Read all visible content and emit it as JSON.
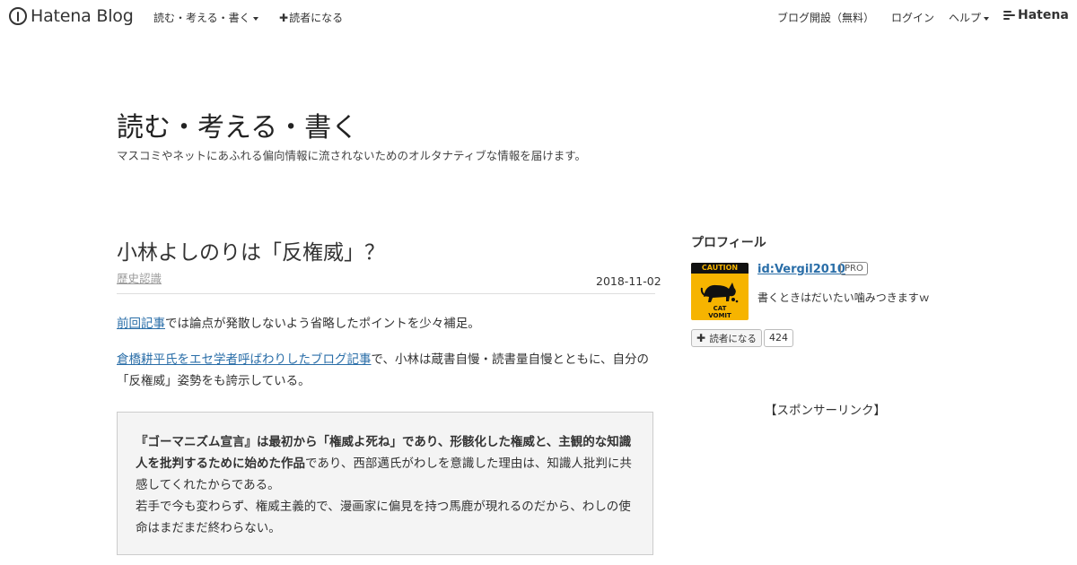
{
  "global_header": {
    "logo_text": "Hatena Blog",
    "blog_menu_label": "読む・考える・書く",
    "subscribe_label": "読者になる",
    "start_blog_label": "ブログ開設（無料）",
    "login_label": "ログイン",
    "help_label": "ヘルプ",
    "hatena_label": "Hatena"
  },
  "blog": {
    "title": "読む・考える・書く",
    "description": "マスコミやネットにあふれる偏向情報に流されないためのオルタナティブな情報を届けます。"
  },
  "entry": {
    "title": "小林よしのりは「反権威」？",
    "category": "歴史認識",
    "date": "2018-11-02",
    "p1_link": "前回記事",
    "p1_text": "では論点が発散しないよう省略したポイントを少々補足。",
    "p2_link": "倉橋耕平氏をエセ学者呼ばわりしたブログ記事",
    "p2_text": "で、小林は蔵書自慢・読書量自慢とともに、自分の「反権威」姿勢をも誇示している。",
    "quote_bold": "『ゴーマニズム宣言』は最初から「権威よ死ね」であり、形骸化した権威と、主観的な知識人を批判するために始めた作品",
    "quote_rest": "であり、西部邁氏がわしを意識した理由は、知識人批判に共感してくれたからである。",
    "quote_line2": "若手で今も変わらず、権威主義的で、漫画家に偏見を持つ馬鹿が現れるのだから、わしの使命はまだまだ終わらない。"
  },
  "sidebar": {
    "profile_title": "プロフィール",
    "avatar_top": "CAUTION",
    "avatar_bottom_1": "CAT",
    "avatar_bottom_2": "VOMIT",
    "user_id": "id:Vergil2010",
    "pro_badge": "PRO",
    "user_desc": "書くときはだいたい噛みつきますｗ",
    "subscribe_label": "読者になる",
    "subscriber_count": "424",
    "sponsor_label": "【スポンサーリンク】"
  }
}
